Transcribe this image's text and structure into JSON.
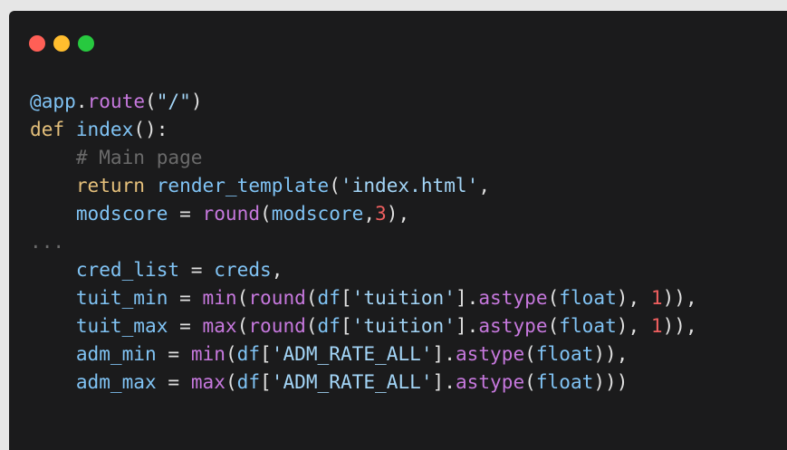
{
  "window": {
    "controls": [
      {
        "name": "close-button",
        "color": "#ff5f56"
      },
      {
        "name": "minimize-button",
        "color": "#ffbd2e"
      },
      {
        "name": "maximize-button",
        "color": "#27c93f"
      }
    ],
    "background": "#1b1b1c"
  },
  "colors": {
    "kw": "#e5c07b",
    "fn": "#c678dd",
    "var": "#80c3f4",
    "plain": "#e0e0e0",
    "str": "#a3d5f7",
    "num": "#ef5f5f",
    "cmt": "#6a6a6a"
  },
  "code_lines": [
    [
      [
        "var",
        "@app"
      ],
      [
        "plain",
        "."
      ],
      [
        "fn",
        "route"
      ],
      [
        "plain",
        "("
      ],
      [
        "str",
        "\"/\""
      ],
      [
        "plain",
        ")"
      ]
    ],
    [
      [
        "kw",
        "def"
      ],
      [
        "plain",
        " "
      ],
      [
        "var",
        "index"
      ],
      [
        "plain",
        "():"
      ]
    ],
    [
      [
        "plain",
        "    "
      ],
      [
        "cmt",
        "# Main page"
      ]
    ],
    [
      [
        "plain",
        "    "
      ],
      [
        "kw",
        "return"
      ],
      [
        "plain",
        " "
      ],
      [
        "var",
        "render_template"
      ],
      [
        "plain",
        "("
      ],
      [
        "str",
        "'index.html'"
      ],
      [
        "plain",
        ","
      ]
    ],
    [
      [
        "plain",
        "    "
      ],
      [
        "var",
        "modscore"
      ],
      [
        "plain",
        " = "
      ],
      [
        "fn",
        "round"
      ],
      [
        "plain",
        "("
      ],
      [
        "var",
        "modscore"
      ],
      [
        "plain",
        ","
      ],
      [
        "num",
        "3"
      ],
      [
        "plain",
        "),"
      ]
    ],
    [
      [
        "cmt",
        "..."
      ]
    ],
    [
      [
        "plain",
        "    "
      ],
      [
        "var",
        "cred_list"
      ],
      [
        "plain",
        " = "
      ],
      [
        "var",
        "creds"
      ],
      [
        "plain",
        ","
      ]
    ],
    [
      [
        "plain",
        "    "
      ],
      [
        "var",
        "tuit_min"
      ],
      [
        "plain",
        " = "
      ],
      [
        "fn",
        "min"
      ],
      [
        "plain",
        "("
      ],
      [
        "fn",
        "round"
      ],
      [
        "plain",
        "("
      ],
      [
        "var",
        "df"
      ],
      [
        "plain",
        "["
      ],
      [
        "str",
        "'tuition'"
      ],
      [
        "plain",
        "]."
      ],
      [
        "fn",
        "astype"
      ],
      [
        "plain",
        "("
      ],
      [
        "var",
        "float"
      ],
      [
        "plain",
        "), "
      ],
      [
        "num",
        "1"
      ],
      [
        "plain",
        ")),"
      ]
    ],
    [
      [
        "plain",
        "    "
      ],
      [
        "var",
        "tuit_max"
      ],
      [
        "plain",
        " = "
      ],
      [
        "fn",
        "max"
      ],
      [
        "plain",
        "("
      ],
      [
        "fn",
        "round"
      ],
      [
        "plain",
        "("
      ],
      [
        "var",
        "df"
      ],
      [
        "plain",
        "["
      ],
      [
        "str",
        "'tuition'"
      ],
      [
        "plain",
        "]."
      ],
      [
        "fn",
        "astype"
      ],
      [
        "plain",
        "("
      ],
      [
        "var",
        "float"
      ],
      [
        "plain",
        "), "
      ],
      [
        "num",
        "1"
      ],
      [
        "plain",
        ")),"
      ]
    ],
    [
      [
        "plain",
        "    "
      ],
      [
        "var",
        "adm_min"
      ],
      [
        "plain",
        " = "
      ],
      [
        "fn",
        "min"
      ],
      [
        "plain",
        "("
      ],
      [
        "var",
        "df"
      ],
      [
        "plain",
        "["
      ],
      [
        "str",
        "'ADM_RATE_ALL'"
      ],
      [
        "plain",
        "]."
      ],
      [
        "fn",
        "astype"
      ],
      [
        "plain",
        "("
      ],
      [
        "var",
        "float"
      ],
      [
        "plain",
        ")),"
      ]
    ],
    [
      [
        "plain",
        "    "
      ],
      [
        "var",
        "adm_max"
      ],
      [
        "plain",
        " = "
      ],
      [
        "fn",
        "max"
      ],
      [
        "plain",
        "("
      ],
      [
        "var",
        "df"
      ],
      [
        "plain",
        "["
      ],
      [
        "str",
        "'ADM_RATE_ALL'"
      ],
      [
        "plain",
        "]."
      ],
      [
        "fn",
        "astype"
      ],
      [
        "plain",
        "("
      ],
      [
        "var",
        "float"
      ],
      [
        "plain",
        ")))"
      ]
    ]
  ]
}
